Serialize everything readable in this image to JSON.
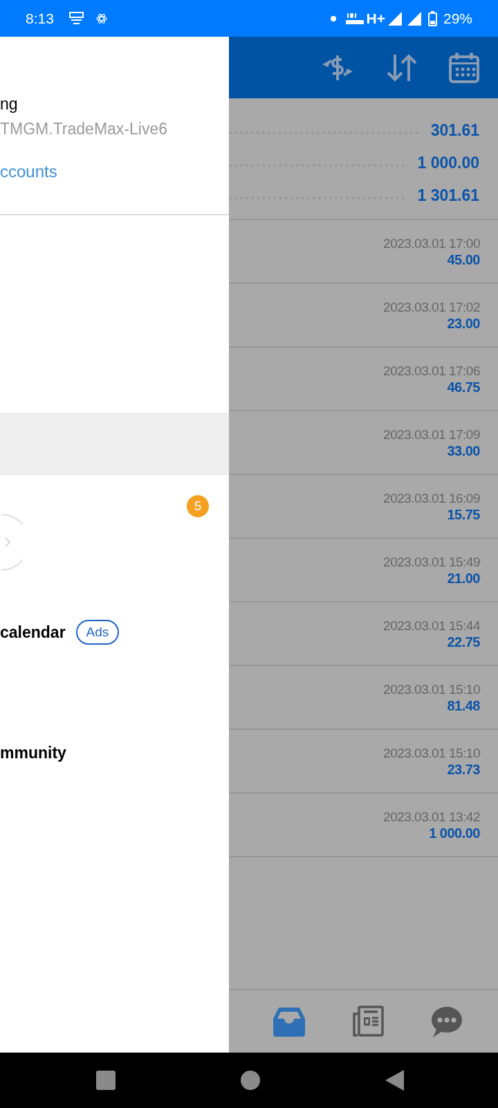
{
  "status_bar": {
    "time": "8:13",
    "network": "H+",
    "battery": "29%"
  },
  "drawer": {
    "account_name": "ng",
    "server": "TMGM.TradeMax-Live6",
    "accounts_link": "ccounts",
    "badge": "5",
    "menu_items": [
      {
        "label": "calendar",
        "tag": "Ads"
      },
      {
        "label": "mmunity"
      }
    ]
  },
  "summary": [
    "301.61",
    "1 000.00",
    "1 301.61"
  ],
  "deals": [
    {
      "time": "2023.03.01 17:00",
      "amount": "45.00"
    },
    {
      "time": "2023.03.01 17:02",
      "amount": "23.00"
    },
    {
      "time": "2023.03.01 17:06",
      "amount": "46.75"
    },
    {
      "time": "2023.03.01 17:09",
      "amount": "33.00"
    },
    {
      "time": "2023.03.01 16:09",
      "amount": "15.75"
    },
    {
      "time": "2023.03.01 15:49",
      "amount": "21.00"
    },
    {
      "time": "2023.03.01 15:44",
      "amount": "22.75"
    },
    {
      "time": "2023.03.01 15:10",
      "amount": "81.48"
    },
    {
      "time": "2023.03.01 15:10",
      "amount": "23.73"
    },
    {
      "time": "2023.03.01 13:42",
      "amount": "1 000.00"
    }
  ],
  "bottom_tabs": [
    {
      "kind": "inbox",
      "selected": true
    },
    {
      "kind": "news",
      "selected": false
    },
    {
      "kind": "chat",
      "selected": false
    }
  ]
}
